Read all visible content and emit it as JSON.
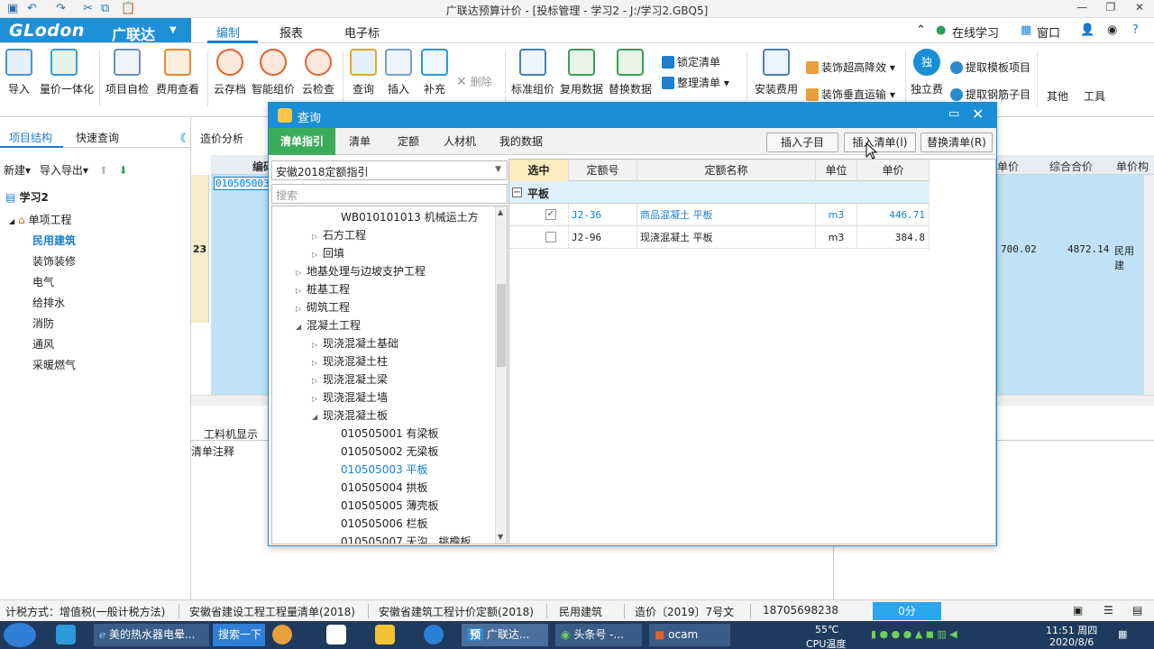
{
  "title_bar": {
    "title": "广联达预算计价 - [投标管理 - 学习2 - J:/学习2.GBQ5]"
  },
  "menu": {
    "brand": "GLodon",
    "brand_cn": "广联达",
    "tabs": [
      "编制",
      "报表",
      "电子标"
    ],
    "online_learning": "在线学习",
    "window": "窗口"
  },
  "ribbon": {
    "buttons": [
      "导入",
      "量价一体化",
      "项目自检",
      "费用查看",
      "云存档",
      "智能组价",
      "云检查",
      "查询",
      "插入",
      "补充",
      "标准组价",
      "复用数据",
      "替换数据",
      "安装费用",
      "独立费",
      "其他",
      "工具"
    ],
    "delete": "删除",
    "lock_list": "锁定清单",
    "arrange_list": "整理清单",
    "decor_height": "装饰超高降效",
    "decor_vertical": "装饰垂直运输",
    "extract_template": "提取模板项目",
    "extract_rebar": "提取钢筋子目"
  },
  "left_panel": {
    "tabs": [
      "项目结构",
      "快速查询"
    ],
    "new": "新建",
    "import_export": "导入导出",
    "project": "学习2",
    "unit_project": "单项工程",
    "items": [
      "民用建筑",
      "装饰装修",
      "电气",
      "给排水",
      "消防",
      "通风",
      "采暖燃气"
    ]
  },
  "main": {
    "tab": "造价分析",
    "head_code": "编码",
    "head_unit_price": "单价",
    "head_total_price": "综合合价",
    "head_unit": "单价构",
    "row_number": "23",
    "row_code": "010505003001",
    "row_price": "700.02",
    "row_total": "4872.14",
    "row_type": "民用建",
    "bottom_tab": "工料机显示",
    "bottom_note": "清单注释"
  },
  "dialog": {
    "title": "查询",
    "tabs": [
      "清单指引",
      "清单",
      "定额",
      "人材机",
      "我的数据"
    ],
    "btn_insert_sub": "插入子目",
    "btn_insert_list": "插入清单(I)",
    "btn_replace_list": "替换清单(R)",
    "select_value": "安徽2018定额指引",
    "search_placeholder": "搜索",
    "tree": [
      "WB010101013  机械运土方",
      "石方工程",
      "回填",
      "地基处理与边坡支护工程",
      "桩基工程",
      "砌筑工程",
      "混凝土工程",
      "现浇混凝土基础",
      "现浇混凝土柱",
      "现浇混凝土梁",
      "现浇混凝土墙",
      "现浇混凝土板",
      "010505001  有梁板",
      "010505002  无梁板",
      "010505003  平板",
      "010505004  拱板",
      "010505005  薄壳板",
      "010505006  栏板",
      "010505007  天沟、挑檐板"
    ],
    "grid_headers": [
      "选中",
      "定额号",
      "定额名称",
      "单位",
      "单价"
    ],
    "group_label": "平板",
    "rows": [
      {
        "code": "J2-36",
        "name": "商品混凝土 平板",
        "unit": "m3",
        "price": "446.71",
        "checked": "✓"
      },
      {
        "code": "J2-96",
        "name": "现浇混凝土 平板",
        "unit": "m3",
        "price": "384.8",
        "checked": ""
      }
    ]
  },
  "status_bar": {
    "items": [
      "计税方式：增值税(一般计税方法)",
      "安徽省建设工程工程量清单(2018)",
      "安徽省建筑工程计价定额(2018)",
      "民用建筑",
      "造价〔2019〕7号文",
      "18705698238"
    ],
    "score": "0分"
  },
  "taskbar": {
    "items": [
      "美的热水器电晕...",
      "搜索一下",
      "广联达...",
      "头条号 -...",
      "ocam"
    ],
    "temp": "55℃",
    "cpu": "CPU温度",
    "time": "11:51 周四",
    "date": "2020/8/6"
  }
}
